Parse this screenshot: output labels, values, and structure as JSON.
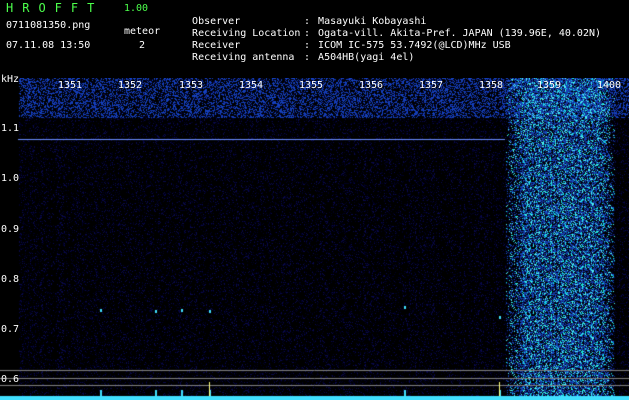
{
  "header": {
    "app_title": "HROFFT",
    "app_version": "1.00",
    "file_name": "0711081350.png",
    "datetime": "07.11.08 13:50",
    "meteor_label": "meteor",
    "meteor_count": "2"
  },
  "info": [
    {
      "label": "Observer",
      "value": "Masayuki Kobayashi"
    },
    {
      "label": "Receiving Location",
      "value": "Ogata-vill. Akita-Pref. JAPAN (139.96E, 40.02N)"
    },
    {
      "label": "Receiver",
      "value": "ICOM IC-575 53.7492(@LCD)MHz USB"
    },
    {
      "label": "Receiving antenna",
      "value": "A504HB(yagi 4el)"
    }
  ],
  "axis": {
    "unit": "kHz",
    "time_ticks": [
      "1351",
      "1352",
      "1353",
      "1354",
      "1355",
      "1356",
      "1357",
      "1358",
      "1359",
      "1400"
    ],
    "freq_ticks": [
      "1.1",
      "1.0",
      "0.9",
      "0.8",
      "0.7",
      "0.6"
    ]
  },
  "colors": {
    "background": "#000000",
    "title_green": "#4CFF4C",
    "signal_blue": "#1E3CFF",
    "signal_cyan": "#40E0FF",
    "grid_line": "#808080",
    "carrier_line": "#6A8CFF"
  }
}
